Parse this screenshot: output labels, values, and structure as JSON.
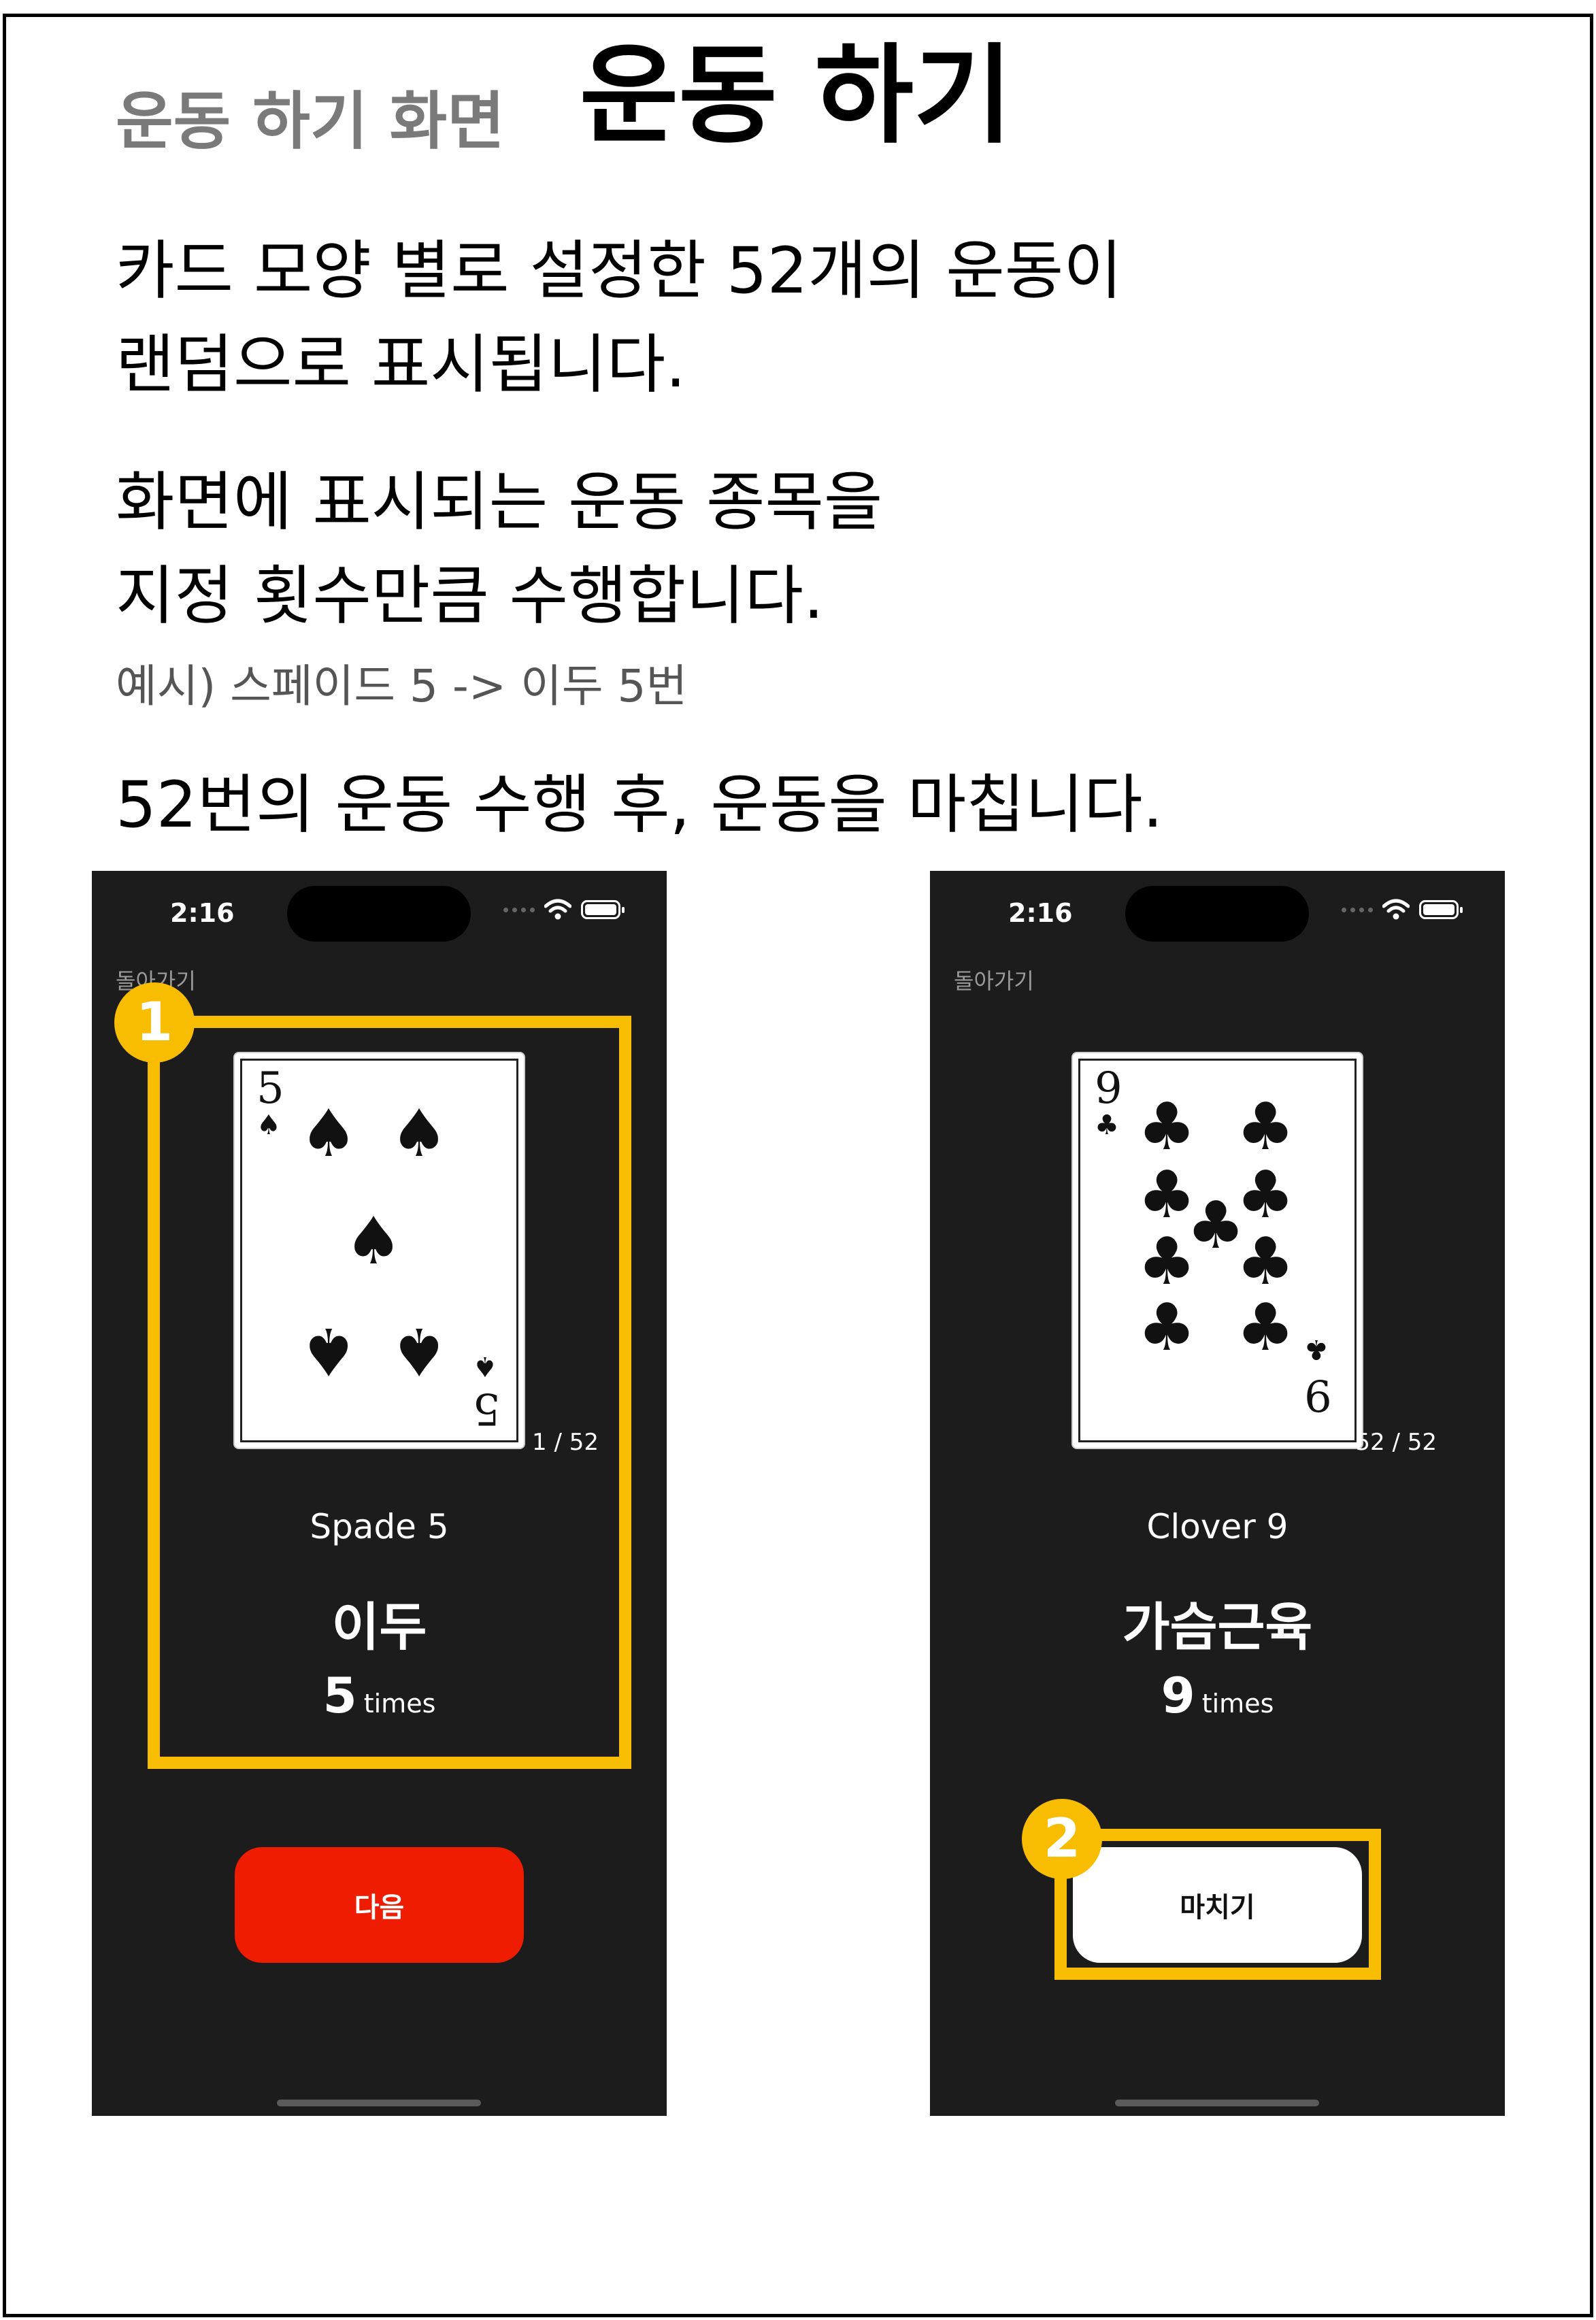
{
  "header": {
    "subtitle": "운동 하기 화면",
    "title": "운동 하기"
  },
  "description": {
    "line1": "카드 모양 별로 설정한 52개의 운동이",
    "line2": "랜덤으로 표시됩니다.",
    "line3": "화면에 표시되는 운동 종목을",
    "line4": "지정 횟수만큼 수행합니다.",
    "example": "예시) 스페이드 5 -> 이두 5번",
    "line5": "52번의 운동 수행 후, 운동을 마칩니다."
  },
  "phone_left": {
    "status_time": "2:16",
    "back_label": "돌아가기",
    "card": {
      "rank": "5",
      "suit_symbol": "♠"
    },
    "counter": "1 / 52",
    "card_name": "Spade 5",
    "exercise": "이두",
    "reps": "5",
    "reps_unit": "times",
    "button_label": "다음"
  },
  "phone_right": {
    "status_time": "2:16",
    "back_label": "돌아가기",
    "card": {
      "rank": "9",
      "suit_symbol": "♣"
    },
    "counter": "52 / 52",
    "card_name": "Clover 9",
    "exercise": "가슴근육",
    "reps": "9",
    "reps_unit": "times",
    "button_label": "마치기"
  },
  "annotations": {
    "badge1": "1",
    "badge2": "2"
  },
  "colors": {
    "highlight": "#f8bd00",
    "next_button": "#ee1c00",
    "phone_bg": "#1c1c1c"
  }
}
